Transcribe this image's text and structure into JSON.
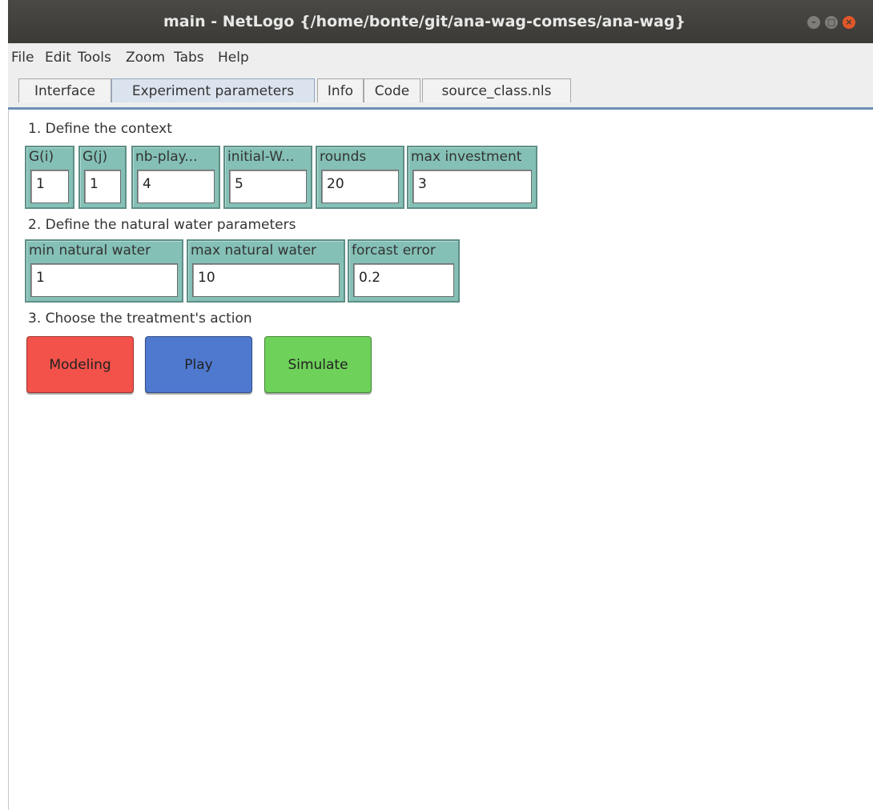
{
  "window": {
    "title": "main - NetLogo {/home/bonte/git/ana-wag-comses/ana-wag}"
  },
  "menu": [
    "File",
    "Edit",
    "Tools",
    "Zoom",
    "Tabs",
    "Help"
  ],
  "tabs": [
    {
      "label": "Interface",
      "active": false
    },
    {
      "label": "Experiment parameters",
      "active": true
    },
    {
      "label": "Info",
      "active": false
    },
    {
      "label": "Code",
      "active": false
    },
    {
      "label": "source_class.nls",
      "active": false
    }
  ],
  "sections": {
    "context": "1. Define the context",
    "water": "2. Define the natural water parameters",
    "action": "3. Choose the treatment's action"
  },
  "context_inputs": [
    {
      "label": "G(i)",
      "value": "1"
    },
    {
      "label": "G(j)",
      "value": "1"
    },
    {
      "label": "nb-play...",
      "value": "4"
    },
    {
      "label": "initial-W...",
      "value": "5"
    },
    {
      "label": "rounds",
      "value": "20"
    },
    {
      "label": "max investment",
      "value": "3"
    }
  ],
  "water_inputs": [
    {
      "label": "min natural water",
      "value": "1"
    },
    {
      "label": "max natural water",
      "value": "10"
    },
    {
      "label": "forcast error",
      "value": "0.2"
    }
  ],
  "actions": [
    {
      "label": "Modeling",
      "color": "#f2524a"
    },
    {
      "label": "Play",
      "color": "#4f79cf"
    },
    {
      "label": "Simulate",
      "color": "#6ed15a"
    }
  ],
  "colors": {
    "input_widget": "#84c0b6",
    "tab_underline": "#6d8fb5"
  }
}
